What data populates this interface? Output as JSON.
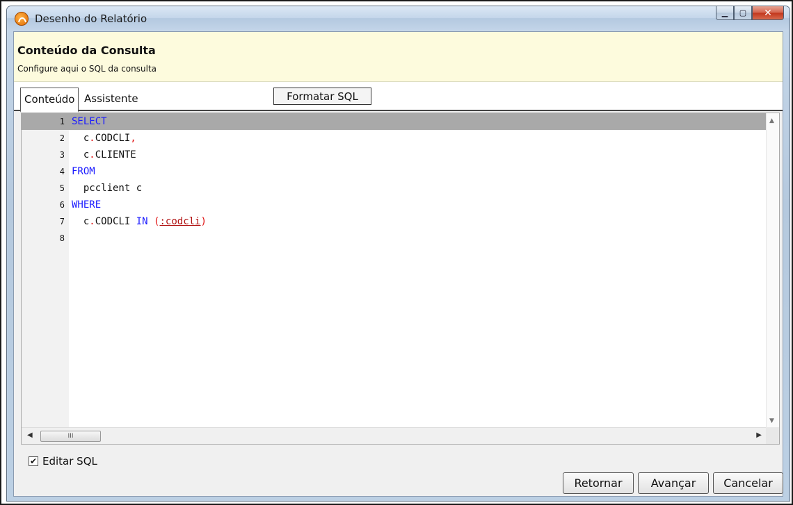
{
  "window": {
    "title": "Desenho do Relatório",
    "controls": {
      "minimize": "▁",
      "maximize": "▢",
      "close": "✕"
    }
  },
  "header": {
    "title": "Conteúdo da Consulta",
    "subtitle": "Configure aqui o SQL da consulta"
  },
  "tabs": [
    {
      "label": "Conteúdo",
      "active": true
    },
    {
      "label": "Assistente",
      "active": false
    }
  ],
  "toolbar": {
    "format_sql_label": "Formatar SQL"
  },
  "editor": {
    "lines": [
      {
        "num": "1",
        "tokens": [
          {
            "t": "SELECT",
            "k": "kw"
          }
        ]
      },
      {
        "num": "2",
        "tokens": [
          {
            "t": "  c",
            "k": ""
          },
          {
            "t": ".",
            "k": "punc"
          },
          {
            "t": "CODCLI",
            "k": ""
          },
          {
            "t": ",",
            "k": "punc"
          }
        ]
      },
      {
        "num": "3",
        "tokens": [
          {
            "t": "  c",
            "k": ""
          },
          {
            "t": ".",
            "k": "punc"
          },
          {
            "t": "CLIENTE",
            "k": ""
          }
        ]
      },
      {
        "num": "4",
        "tokens": [
          {
            "t": "FROM",
            "k": "kw"
          }
        ]
      },
      {
        "num": "5",
        "tokens": [
          {
            "t": "  pcclient c",
            "k": ""
          }
        ]
      },
      {
        "num": "6",
        "tokens": [
          {
            "t": "WHERE",
            "k": "kw"
          }
        ]
      },
      {
        "num": "7",
        "tokens": [
          {
            "t": "  c",
            "k": ""
          },
          {
            "t": ".",
            "k": "punc"
          },
          {
            "t": "CODCLI ",
            "k": ""
          },
          {
            "t": "IN",
            "k": "kw"
          },
          {
            "t": " ",
            "k": ""
          },
          {
            "t": "(",
            "k": "punc"
          },
          {
            "t": ":codcli",
            "k": "param"
          },
          {
            "t": ")",
            "k": "punc"
          }
        ]
      },
      {
        "num": "8",
        "tokens": []
      }
    ],
    "current_line": 1,
    "hscroll_thumb_grip": "III"
  },
  "edit_sql": {
    "label": "Editar SQL",
    "checked": true
  },
  "buttons": {
    "back": "Retornar",
    "next": "Avançar",
    "cancel": "Cancelar"
  }
}
